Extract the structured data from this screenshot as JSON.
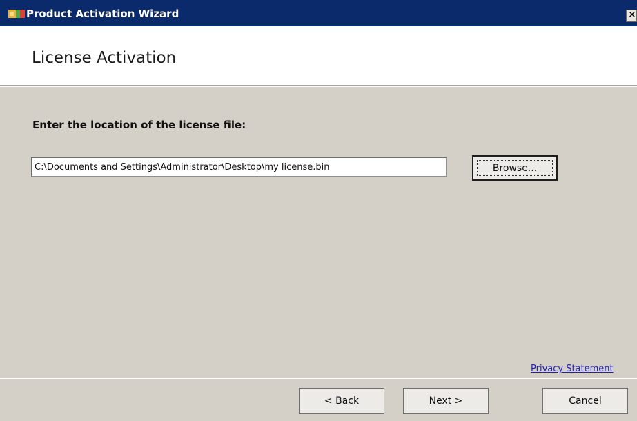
{
  "window": {
    "title": "Product Activation Wizard",
    "close_glyph": "✕",
    "app_icon": "wizard-flag-icon"
  },
  "header": {
    "title": "License Activation"
  },
  "main": {
    "instruction": "Enter the location of the license file:",
    "license_path_value": "C:\\Documents and Settings\\Administrator\\Desktop\\my license.bin",
    "browse_label": "Browse...",
    "privacy_link": "Privacy Statement"
  },
  "footer": {
    "back_label": "< Back",
    "next_label": "Next >",
    "cancel_label": "Cancel"
  },
  "colors": {
    "titlebar": "#0b2a6b",
    "dialog_background": "#d4d0c8",
    "link": "#2222b8"
  }
}
